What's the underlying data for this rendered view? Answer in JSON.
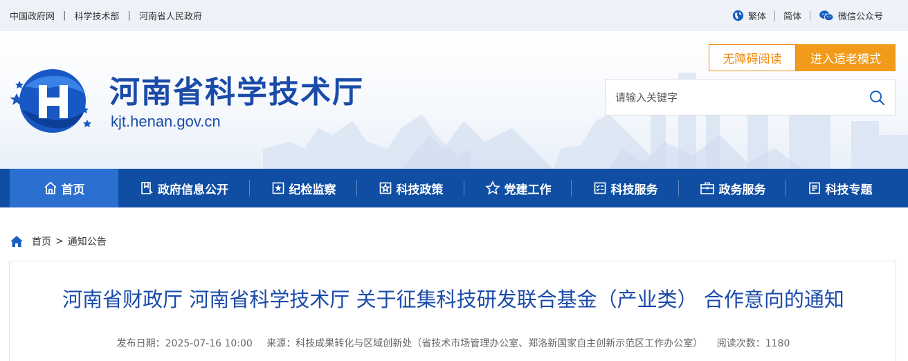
{
  "topbar": {
    "links": [
      "中国政府网",
      "科学技术部",
      "河南省人民政府"
    ],
    "separator": "|",
    "traditional": "繁体",
    "simplified": "简体",
    "wechat": "微信公众号"
  },
  "header": {
    "title": "河南省科学技术厅",
    "domain": "kjt.henan.gov.cn",
    "accessible_label": "无障碍阅读",
    "elder_label": "进入适老模式",
    "search_placeholder": "请输入关键字"
  },
  "nav": {
    "items": [
      {
        "label": "首页",
        "icon": "home-icon"
      },
      {
        "label": "政府信息公开",
        "icon": "info-public-icon"
      },
      {
        "label": "纪检监察",
        "icon": "inspection-icon"
      },
      {
        "label": "科技政策",
        "icon": "policy-icon"
      },
      {
        "label": "党建工作",
        "icon": "star-icon"
      },
      {
        "label": "科技服务",
        "icon": "checklist-icon"
      },
      {
        "label": "政务服务",
        "icon": "briefcase-icon"
      },
      {
        "label": "科技专题",
        "icon": "document-icon"
      }
    ]
  },
  "breadcrumb": {
    "home": "首页",
    "gt": ">",
    "current": "通知公告"
  },
  "article": {
    "title": "河南省财政厅 河南省科学技术厅 关于征集科技研发联合基金（产业类） 合作意向的通知",
    "publish_label": "发布日期：",
    "publish_date": "2025-07-16 10:00",
    "source_label": "来源：",
    "source": "科技成果转化与区域创新处（省技术市场管理办公室、郑洛新国家自主创新示范区工作办公室）",
    "views_label": "阅读次数：",
    "views": "1180"
  },
  "colors": {
    "brand_blue": "#1a4ba8",
    "nav_blue": "#0f4ea3",
    "nav_active": "#2b6fd1",
    "orange": "#f29a1a"
  }
}
